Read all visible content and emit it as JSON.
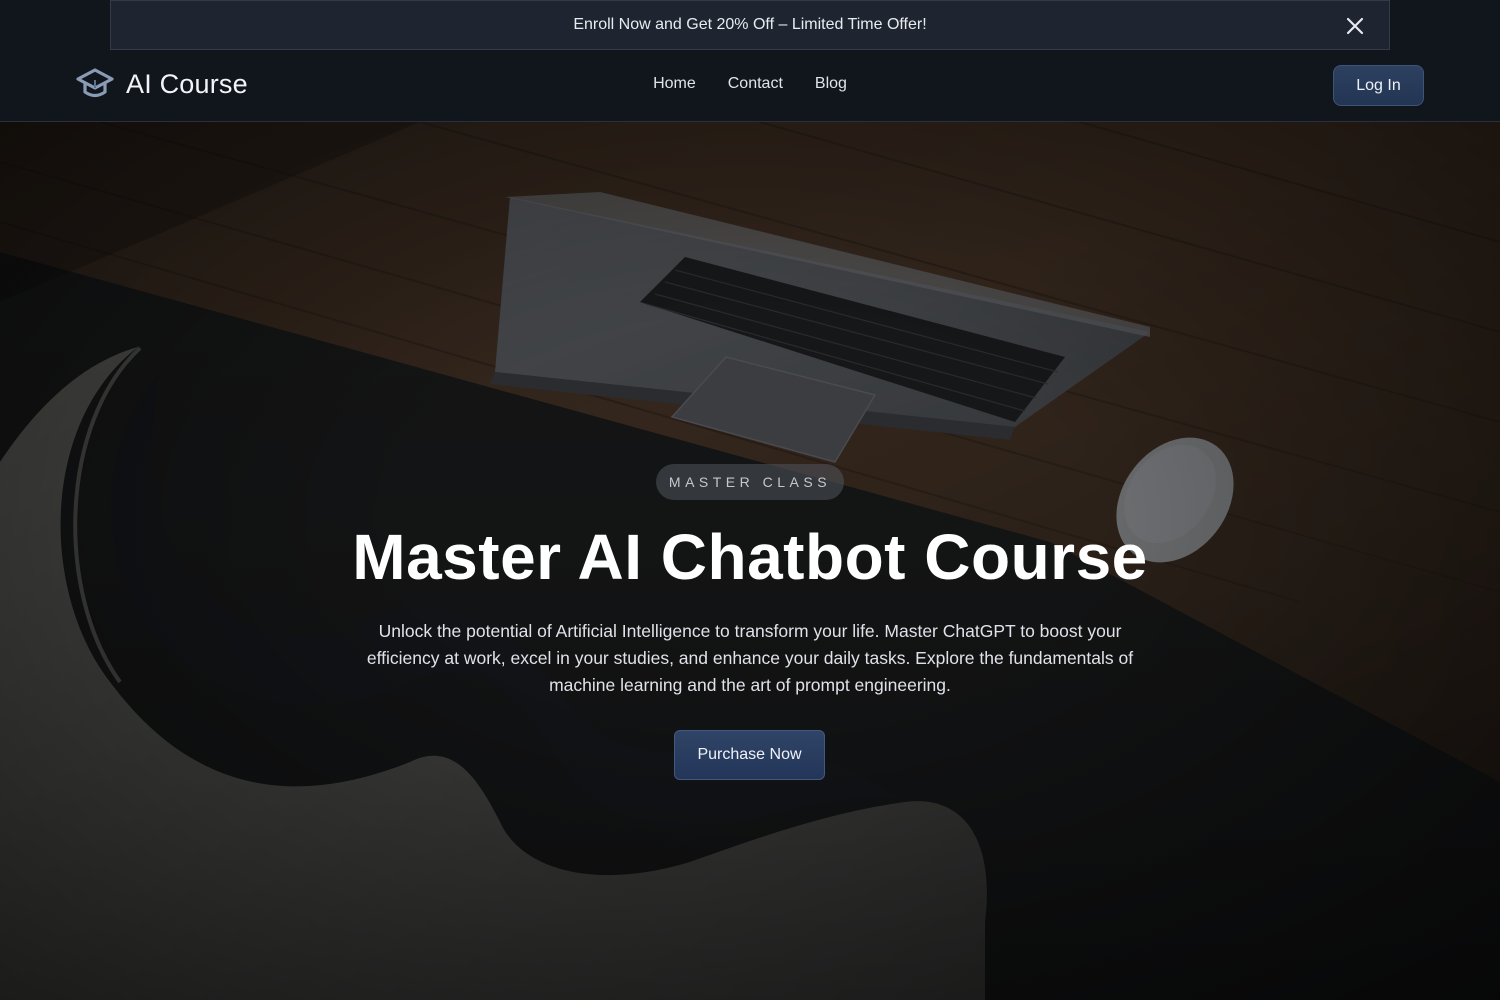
{
  "promo": {
    "text": "Enroll Now and Get 20% Off – Limited Time Offer!",
    "close_icon": "close-icon"
  },
  "brand": {
    "name": "AI Course",
    "icon": "graduation-cap-icon",
    "icon_color": "#8a9bb5"
  },
  "nav": {
    "links": [
      "Home",
      "Contact",
      "Blog"
    ],
    "login_label": "Log In"
  },
  "hero": {
    "badge": "MASTER CLASS",
    "title": "Master AI Chatbot Course",
    "description": "Unlock the potential of Artificial Intelligence to transform your life. Master ChatGPT to boost your efficiency at work, excel in your studies, and enhance your daily tasks. Explore the fundamentals of machine learning and the art of prompt engineering.",
    "cta_label": "Purchase Now",
    "background_image": "laptop-on-wooden-desk-with-chair-photo"
  },
  "colors": {
    "accent": "#2a3d5e",
    "topbar_bg": "#11151c",
    "promo_bg": "#1f2530"
  }
}
